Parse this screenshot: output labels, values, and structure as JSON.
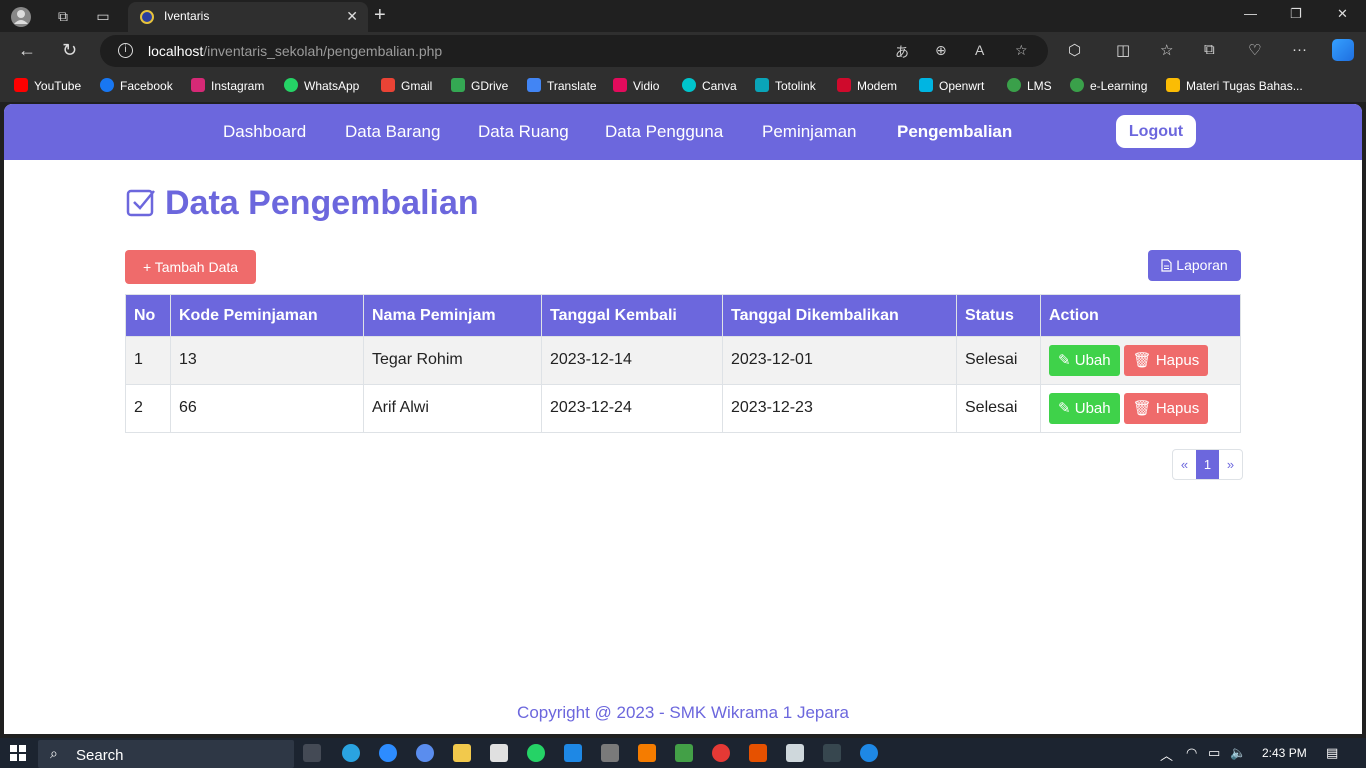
{
  "browser": {
    "tab_title": "Iventaris",
    "url_host": "localhost",
    "url_path": "/inventaris_sekolah/pengembalian.php",
    "bookmarks": [
      "YouTube",
      "Facebook",
      "Instagram",
      "WhatsApp",
      "Gmail",
      "GDrive",
      "Translate",
      "Vidio",
      "Canva",
      "Totolink",
      "Modem",
      "Openwrt",
      "LMS",
      "e-Learning",
      "Materi Tugas Bahas..."
    ]
  },
  "nav": {
    "items": [
      "Dashboard",
      "Data Barang",
      "Data Ruang",
      "Data Pengguna",
      "Peminjaman",
      "Pengembalian"
    ],
    "active": "Pengembalian",
    "logout": "Logout"
  },
  "page": {
    "title": "Data Pengembalian",
    "add_button": "+ Tambah Data",
    "report_button": "Laporan"
  },
  "table": {
    "headers": [
      "No",
      "Kode Peminjaman",
      "Nama Peminjam",
      "Tanggal Kembali",
      "Tanggal Dikembalikan",
      "Status",
      "Action"
    ],
    "rows": [
      {
        "no": "1",
        "kode": "13",
        "nama": "Tegar Rohim",
        "kembali": "2023-12-14",
        "dikembalikan": "2023-12-01",
        "status": "Selesai"
      },
      {
        "no": "2",
        "kode": "66",
        "nama": "Arif Alwi",
        "kembali": "2023-12-24",
        "dikembalikan": "2023-12-23",
        "status": "Selesai"
      }
    ],
    "edit_label": "Ubah",
    "delete_label": "Hapus"
  },
  "pagination": {
    "prev": "«",
    "current": "1",
    "next": "»"
  },
  "footer": "Copyright @ 2023 - SMK Wikrama 1 Jepara",
  "taskbar": {
    "search_placeholder": "Search",
    "time": "2:43 PM"
  },
  "colors": {
    "accent": "#6c67dd",
    "danger": "#ef6b6b",
    "success": "#3fd24a"
  }
}
